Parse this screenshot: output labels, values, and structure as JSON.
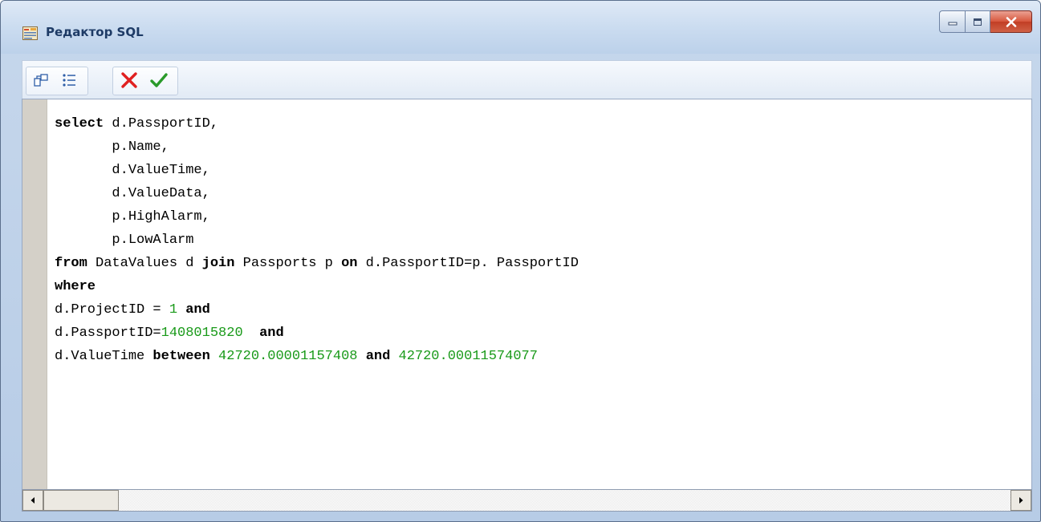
{
  "window": {
    "title": "Редактор SQL"
  },
  "toolbar": {
    "buttons": [
      {
        "icon": "format-sql-icon"
      },
      {
        "icon": "list-icon"
      },
      {
        "icon": "cancel-icon",
        "color": "#e02020"
      },
      {
        "icon": "apply-check-icon",
        "color": "#2a9a2a"
      }
    ]
  },
  "editor": {
    "lines": [
      [
        {
          "t": "select",
          "c": "kw"
        },
        {
          "t": " d.PassportID,"
        }
      ],
      [
        {
          "t": "       p.Name,"
        }
      ],
      [
        {
          "t": "       d.ValueTime,"
        }
      ],
      [
        {
          "t": "       d.ValueData,"
        }
      ],
      [
        {
          "t": "       p.HighAlarm,"
        }
      ],
      [
        {
          "t": "       p.LowAlarm"
        }
      ],
      [
        {
          "t": "from",
          "c": "kw"
        },
        {
          "t": " DataValues d "
        },
        {
          "t": "join",
          "c": "kw"
        },
        {
          "t": " Passports p "
        },
        {
          "t": "on",
          "c": "kw"
        },
        {
          "t": " d.PassportID=p. PassportID"
        }
      ],
      [
        {
          "t": "where",
          "c": "kw"
        }
      ],
      [
        {
          "t": "d.ProjectID = "
        },
        {
          "t": "1",
          "c": "num"
        },
        {
          "t": " "
        },
        {
          "t": "and",
          "c": "kw"
        }
      ],
      [
        {
          "t": "d.PassportID="
        },
        {
          "t": "1408015820",
          "c": "num"
        },
        {
          "t": "  "
        },
        {
          "t": "and",
          "c": "kw"
        }
      ],
      [
        {
          "t": "d.ValueTime "
        },
        {
          "t": "between",
          "c": "kw"
        },
        {
          "t": " "
        },
        {
          "t": "42720.00001157408",
          "c": "num"
        },
        {
          "t": " "
        },
        {
          "t": "and",
          "c": "kw"
        },
        {
          "t": " "
        },
        {
          "t": "42720.00011574077",
          "c": "num"
        }
      ]
    ],
    "number_color": "#1a9a1a"
  }
}
